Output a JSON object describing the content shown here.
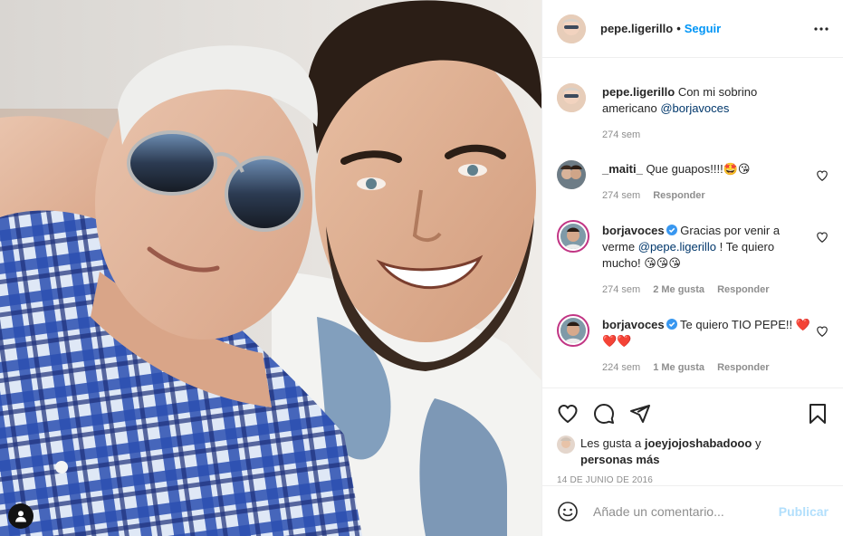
{
  "post": {
    "author": "pepe.ligerillo",
    "separator": "•",
    "follow_label": "Seguir",
    "caption_text": "Con mi sobrino americano",
    "caption_mention": "@borjavoces",
    "caption_time": "274 sem"
  },
  "comments": [
    {
      "user": "_maiti_",
      "text": "Que guapos!!!!🤩😘",
      "time": "274 sem",
      "likes": "",
      "reply": "Responder",
      "verified": false
    },
    {
      "user": "borjavoces",
      "text_before": "Gracias por venir a verme",
      "mention": "@pepe.ligerillo",
      "text_after": "! Te quiero mucho! 😘😘😘",
      "time": "274 sem",
      "likes": "2 Me gusta",
      "reply": "Responder",
      "verified": true
    },
    {
      "user": "borjavoces",
      "text": "Te quiero TIO PEPE!! ❤️❤️❤️",
      "time": "224 sem",
      "likes": "1 Me gusta",
      "reply": "Responder",
      "verified": true
    }
  ],
  "likes": {
    "prefix": "Les gusta a",
    "user": "joeyjojoshabadooo",
    "and": "y",
    "others": "personas más"
  },
  "date": "14 DE JUNIO DE 2016",
  "composer": {
    "placeholder": "Añade un comentario...",
    "publish_label": "Publicar"
  },
  "icons": {
    "more": "more-options-icon",
    "like": "heart-icon",
    "comment": "comment-icon",
    "share": "share-icon",
    "save": "bookmark-icon",
    "emoji": "emoji-icon",
    "tags": "user-tag-icon",
    "verified": "verified-badge-icon"
  },
  "colors": {
    "accent": "#0095f6",
    "mention": "#00376b",
    "muted": "#8e8e8e",
    "publish_disabled": "#b2dffc",
    "heart_red": "#ed4956",
    "verified_blue": "#3897f0"
  }
}
